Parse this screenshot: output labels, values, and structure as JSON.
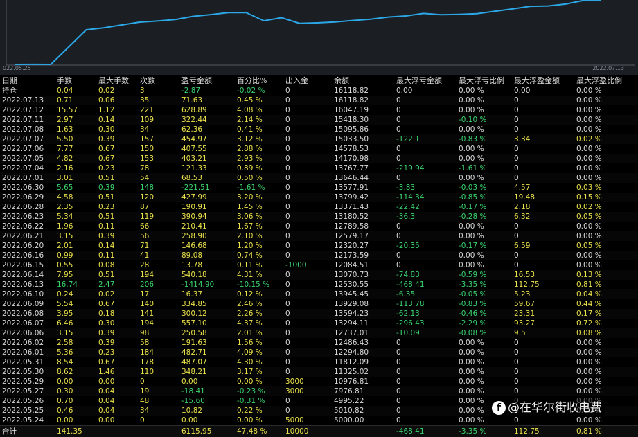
{
  "colors": {
    "yellow": "#e8e04a",
    "green": "#3ad46e",
    "white": "#d8d8d8",
    "line": "#2ca8e8"
  },
  "chart": {
    "x_start_label": "022.05.25",
    "x_end_label": "2022.07.13",
    "balance_series": [
      5000.0,
      5010.82,
      4995.22,
      7976.81,
      10976.81,
      11325.02,
      11812.09,
      12294.8,
      12486.43,
      12737.01,
      13294.11,
      13594.23,
      13929.08,
      13945.45,
      12530.55,
      13070.73,
      12084.51,
      12173.59,
      12320.27,
      12579.17,
      12789.58,
      13180.52,
      13371.43,
      13799.42,
      13577.91,
      13646.44,
      13767.77,
      14170.98,
      14578.53,
      15033.5,
      15095.86,
      15418.3,
      16047.19,
      16118.82
    ]
  },
  "headers": [
    "日期",
    "手数",
    "最大手数",
    "次数",
    "盈亏金额",
    "百分比%",
    "出入金",
    "余额",
    "最大浮亏金额",
    "最大浮亏比例",
    "最大浮盈金额",
    "最大浮盈比例"
  ],
  "rows": [
    [
      "持仓",
      "0.04",
      "0.02",
      "3",
      "-2.87",
      "-0.02 %",
      "0",
      "16118.82",
      "0.00",
      "0.00 %",
      "0.00",
      "0.00 %"
    ],
    [
      "2022.07.13",
      "0.71",
      "0.06",
      "35",
      "71.63",
      "0.45 %",
      "0",
      "16118.82",
      "0",
      "0.00 %",
      "0",
      "0.00 %"
    ],
    [
      "2022.07.12",
      "15.57",
      "1.12",
      "221",
      "628.89",
      "4.08 %",
      "0",
      "16047.19",
      "0",
      "0.00 %",
      "0",
      "0.00 %"
    ],
    [
      "2022.07.11",
      "2.97",
      "0.14",
      "109",
      "322.44",
      "2.14 %",
      "0",
      "15418.30",
      "0",
      "-0.10 %",
      "0",
      "0.00 %"
    ],
    [
      "2022.07.08",
      "1.63",
      "0.30",
      "34",
      "62.36",
      "0.41 %",
      "0",
      "15095.86",
      "0",
      "0.00 %",
      "0",
      "0.00 %"
    ],
    [
      "2022.07.07",
      "5.50",
      "0.39",
      "157",
      "454.97",
      "3.12 %",
      "0",
      "15033.50",
      "-122.1",
      "-0.83 %",
      "3.34",
      "0.02 %"
    ],
    [
      "2022.07.06",
      "7.77",
      "0.67",
      "150",
      "407.55",
      "2.88 %",
      "0",
      "14578.53",
      "0",
      "0.00 %",
      "0",
      "0.00 %"
    ],
    [
      "2022.07.05",
      "4.82",
      "0.67",
      "153",
      "403.21",
      "2.93 %",
      "0",
      "14170.98",
      "0",
      "0.00 %",
      "0",
      "0.00 %"
    ],
    [
      "2022.07.04",
      "2.16",
      "0.23",
      "78",
      "121.33",
      "0.89 %",
      "0",
      "13767.77",
      "-219.94",
      "-1.61 %",
      "0",
      "0.00 %"
    ],
    [
      "2022.07.01",
      "3.01",
      "0.51",
      "54",
      "68.53",
      "0.50 %",
      "0",
      "13646.44",
      "0",
      "0.00 %",
      "0",
      "0.00 %"
    ],
    [
      "2022.06.30",
      "5.65",
      "0.39",
      "148",
      "-221.51",
      "-1.61 %",
      "0",
      "13577.91",
      "-3.83",
      "-0.03 %",
      "4.57",
      "0.03 %"
    ],
    [
      "2022.06.29",
      "4.58",
      "0.51",
      "120",
      "427.99",
      "3.20 %",
      "0",
      "13799.42",
      "-114.34",
      "-0.85 %",
      "19.48",
      "0.15 %"
    ],
    [
      "2022.06.28",
      "2.35",
      "0.23",
      "87",
      "190.91",
      "1.45 %",
      "0",
      "13371.43",
      "-22.42",
      "-0.17 %",
      "2.18",
      "0.02 %"
    ],
    [
      "2022.06.23",
      "5.34",
      "0.51",
      "119",
      "390.94",
      "3.06 %",
      "0",
      "13180.52",
      "-36.3",
      "-0.28 %",
      "6.32",
      "0.05 %"
    ],
    [
      "2022.06.22",
      "1.96",
      "0.11",
      "66",
      "210.41",
      "1.67 %",
      "0",
      "12789.58",
      "0",
      "0.00 %",
      "0",
      "0.00 %"
    ],
    [
      "2022.06.21",
      "3.15",
      "0.39",
      "56",
      "258.90",
      "2.10 %",
      "0",
      "12579.17",
      "0",
      "0.00 %",
      "0",
      "0.00 %"
    ],
    [
      "2022.06.20",
      "2.01",
      "0.14",
      "71",
      "146.68",
      "1.20 %",
      "0",
      "12320.27",
      "-20.35",
      "-0.17 %",
      "6.59",
      "0.05 %"
    ],
    [
      "2022.06.16",
      "0.99",
      "0.11",
      "41",
      "89.08",
      "0.74 %",
      "0",
      "12173.59",
      "0",
      "0.00 %",
      "0",
      "0.00 %"
    ],
    [
      "2022.06.15",
      "0.55",
      "0.08",
      "28",
      "13.78",
      "0.11 %",
      "-1000",
      "12084.51",
      "0",
      "0.00 %",
      "0",
      "0.00 %"
    ],
    [
      "2022.06.14",
      "7.95",
      "0.51",
      "194",
      "540.18",
      "4.31 %",
      "0",
      "13070.73",
      "-74.83",
      "-0.59 %",
      "16.53",
      "0.13 %"
    ],
    [
      "2022.06.13",
      "16.74",
      "2.47",
      "206",
      "-1414.90",
      "-10.15 %",
      "0",
      "12530.55",
      "-468.41",
      "-3.35 %",
      "112.75",
      "0.81 %"
    ],
    [
      "2022.06.10",
      "0.24",
      "0.02",
      "17",
      "16.37",
      "0.12 %",
      "0",
      "13945.45",
      "-6.35",
      "-0.05 %",
      "5.23",
      "0.04 %"
    ],
    [
      "2022.06.09",
      "5.54",
      "0.67",
      "140",
      "334.85",
      "2.46 %",
      "0",
      "13929.08",
      "-113.78",
      "-0.83 %",
      "59.67",
      "0.44 %"
    ],
    [
      "2022.06.08",
      "3.95",
      "0.18",
      "141",
      "300.12",
      "2.26 %",
      "0",
      "13594.23",
      "-62.13",
      "-0.46 %",
      "23.31",
      "0.17 %"
    ],
    [
      "2022.06.07",
      "6.46",
      "0.30",
      "194",
      "557.10",
      "4.37 %",
      "0",
      "13294.11",
      "-296.43",
      "-2.29 %",
      "93.27",
      "0.72 %"
    ],
    [
      "2022.06.06",
      "3.15",
      "0.39",
      "98",
      "250.58",
      "2.01 %",
      "0",
      "12737.01",
      "-10.09",
      "-0.08 %",
      "9.5",
      "0.08 %"
    ],
    [
      "2022.06.02",
      "2.58",
      "0.39",
      "58",
      "191.63",
      "1.56 %",
      "0",
      "12486.43",
      "0",
      "0.00 %",
      "0",
      "0.00 %"
    ],
    [
      "2022.06.01",
      "5.36",
      "0.23",
      "184",
      "482.71",
      "4.09 %",
      "0",
      "12294.80",
      "0",
      "0.00 %",
      "0",
      "0.00 %"
    ],
    [
      "2022.05.31",
      "8.54",
      "0.67",
      "178",
      "487.07",
      "4.30 %",
      "0",
      "11812.09",
      "0",
      "0.00 %",
      "0",
      "0.00 %"
    ],
    [
      "2022.05.30",
      "8.62",
      "1.46",
      "110",
      "348.21",
      "3.17 %",
      "0",
      "11325.02",
      "0",
      "0.00 %",
      "0",
      "0.00 %"
    ],
    [
      "2022.05.29",
      "0.00",
      "0.00",
      "0",
      "0.00",
      "0.00 %",
      "3000",
      "10976.81",
      "0",
      "0.00 %",
      "0",
      "0.00 %"
    ],
    [
      "2022.05.27",
      "0.30",
      "0.04",
      "19",
      "-18.41",
      "-0.23 %",
      "3000",
      "7976.81",
      "0",
      "0.00 %",
      "0",
      "0.00 %"
    ],
    [
      "2022.05.26",
      "0.70",
      "0.04",
      "48",
      "-15.60",
      "-0.31 %",
      "0",
      "4995.22",
      "0",
      "0.00 %",
      "0",
      "0.00 %"
    ],
    [
      "2022.05.25",
      "0.46",
      "0.04",
      "34",
      "10.82",
      "0.22 %",
      "0",
      "5010.82",
      "0",
      "0.00 %",
      "0",
      "0.00 %"
    ],
    [
      "2022.05.24",
      "0.00",
      "0.00",
      "0",
      "0.00",
      "0.00 %",
      "5000",
      "5000.00",
      "0",
      "0.00 %",
      "0",
      "0.00 %"
    ]
  ],
  "total_row": [
    "合计",
    "141.35",
    "",
    "",
    "6115.95",
    "47.48 %",
    "10000",
    "",
    "-468.41",
    "-3.35 %",
    "112.75",
    "0.81 %"
  ],
  "watermark": {
    "logo": "f",
    "text": "@在华尔街收电费"
  }
}
